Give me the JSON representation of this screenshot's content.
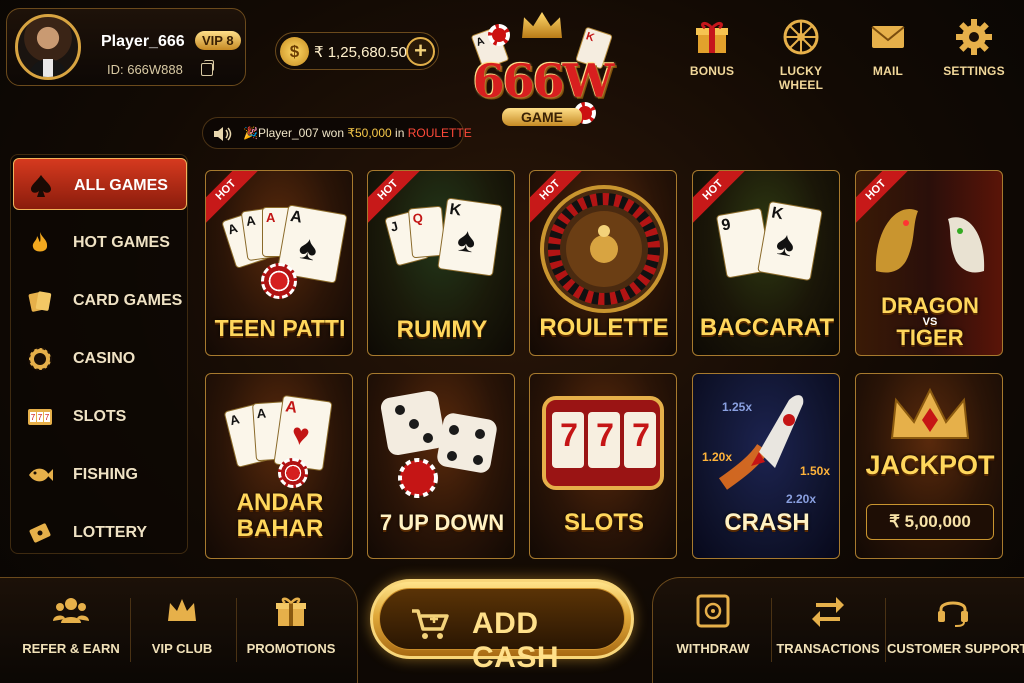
{
  "profile": {
    "name": "Player_666",
    "vip": "VIP 8",
    "id": "ID: 666W888"
  },
  "balance": {
    "amount": "₹ 1,25,680.50",
    "coin_symbol": "$"
  },
  "logo": {
    "title": "666W",
    "subtitle": "GAME",
    "card_a": "A",
    "card_k": "K"
  },
  "header_actions": [
    {
      "label": "BONUS",
      "icon": "gift-icon"
    },
    {
      "label": "LUCKY WHEEL",
      "icon": "wheel-icon"
    },
    {
      "label": "MAIL",
      "icon": "mail-icon"
    },
    {
      "label": "SETTINGS",
      "icon": "gear-icon"
    }
  ],
  "ticker": {
    "player": "Player_007 won ",
    "amount": "₹50,000",
    "in": " in ",
    "game": "ROULETTE"
  },
  "sidebar": {
    "items": [
      {
        "label": "ALL GAMES",
        "icon": "spade-icon",
        "active": true
      },
      {
        "label": "HOT GAMES",
        "icon": "flame-icon",
        "active": false
      },
      {
        "label": "CARD GAMES",
        "icon": "cards-icon",
        "active": false
      },
      {
        "label": "CASINO",
        "icon": "chip-icon",
        "active": false
      },
      {
        "label": "SLOTS",
        "icon": "slot-icon",
        "active": false
      },
      {
        "label": "FISHING",
        "icon": "fish-icon",
        "active": false
      },
      {
        "label": "LOTTERY",
        "icon": "ticket-icon",
        "active": false
      }
    ]
  },
  "games": {
    "hot_label": "HOT",
    "teen_patti": "TEEN PATTI",
    "rummy": "RUMMY",
    "roulette": "ROULETTE",
    "baccarat": "BACCARAT",
    "dragon": "DRAGON",
    "vs": "VS",
    "tiger": "TIGER",
    "andar": "ANDAR",
    "bahar": "BAHAR",
    "seven_up_down": "7 UP DOWN",
    "slots": "SLOTS",
    "crash": "CRASH",
    "jackpot": "JACKPOT",
    "jackpot_amount": "₹ 5,00,000",
    "crash_multipliers": [
      "1.25x",
      "1.20x",
      "1.50x",
      "2.20x"
    ],
    "slot_reels": [
      "7",
      "7",
      "7"
    ]
  },
  "bottom_nav": {
    "refer": "REFER & EARN",
    "vip_club": "VIP CLUB",
    "promotions": "PROMOTIONS",
    "add_cash": "ADD CASH",
    "withdraw": "WITHDRAW",
    "transactions": "TRANSACTIONS",
    "support": "CUSTOMER SUPPORT"
  },
  "colors": {
    "gold": "#f7d27a",
    "accent_red": "#d63a1f",
    "hot_red": "#c71919"
  }
}
